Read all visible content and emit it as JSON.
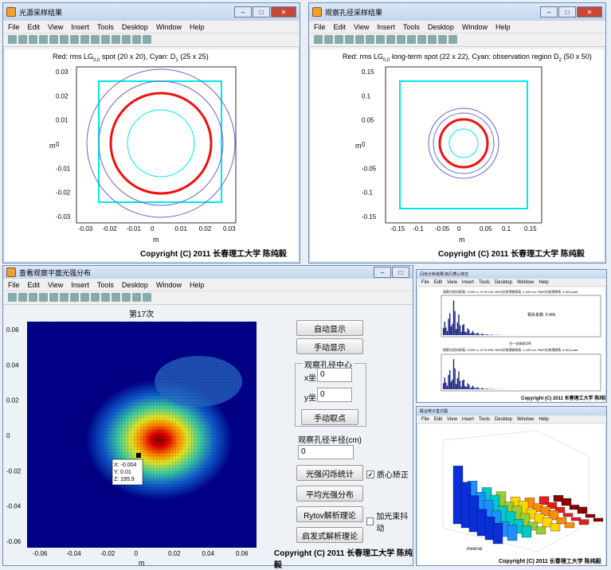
{
  "w1": {
    "title": "光源采样结果",
    "menu": [
      "File",
      "Edit",
      "View",
      "Insert",
      "Tools",
      "Desktop",
      "Window",
      "Help"
    ],
    "plot_title": "Red: rms LG",
    "plot_title_sub": "0,0",
    "plot_title_rest": " spot (20 x 20), Cyan: D",
    "plot_title_sub2": "1",
    "plot_title_end": " (25 x 25)",
    "ylabel": "m",
    "xlabel": "m",
    "xticks": [
      "-0.03",
      "-0.02",
      "-0.01",
      "0",
      "0.01",
      "0.02",
      "0.03"
    ],
    "yticks": [
      "0.03",
      "0.02",
      "0.01",
      "0",
      "-0.01",
      "-0.02",
      "-0.03"
    ],
    "copyright": "Copyright (C) 2011 长春理工大学 陈纯毅"
  },
  "w2": {
    "title": "观察孔径采样结果",
    "menu": [
      "File",
      "Edit",
      "View",
      "Insert",
      "Tools",
      "Desktop",
      "Window",
      "Help"
    ],
    "plot_title": "Red: rms LG",
    "plot_title_sub": "0,0",
    "plot_title_rest": " long-term  spot (22 x 22), Cyan: observation region D",
    "plot_title_sub2": "2",
    "plot_title_end": " (50 x 50)",
    "ylabel": "m",
    "xlabel": "m",
    "xticks": [
      "-0.15",
      "-0.1",
      "-0.05",
      "0",
      "0.05",
      "0.1",
      "0.15"
    ],
    "yticks": [
      "0.15",
      "0.1",
      "0.05",
      "0",
      "-0.05",
      "-0.1",
      "-0.15"
    ],
    "copyright": "Copyright (C) 2011 长春理工大学 陈纯毅"
  },
  "w3": {
    "title": "查看观察平面光强分布",
    "menu": [
      "File",
      "Edit",
      "View",
      "Insert",
      "Tools",
      "Desktop",
      "Window",
      "Help"
    ],
    "plot_title": "第17次",
    "xticks": [
      "-0.06",
      "-0.04",
      "-0.02",
      "0",
      "0.02",
      "0.04",
      "0.06"
    ],
    "yticks": [
      "0.06",
      "0.04",
      "0.02",
      "0",
      "-0.02",
      "-0.04",
      "-0.06"
    ],
    "xlabel": "m",
    "tooltip": [
      "X: -0.004",
      "Y: 0.01",
      "Z: 195.9"
    ],
    "auto_btn": "自动显示",
    "manual_btn": "手动显示",
    "group_label": "观察孔径中心",
    "x_label": "x坐",
    "x_value": "0",
    "y_label": "y坐",
    "y_value": "0",
    "pick_btn": "手动取点",
    "radius_label": "观察孔径半径(cm)",
    "radius_value": "0",
    "stat_btn": "光强闪烁统计",
    "centroid_label": "质心矫正",
    "avg_btn": "平均光强分布",
    "rytov_btn": "Rytov解析理论",
    "wander_label": "加光束抖动",
    "heur_btn": "启发式解析理论",
    "copyright": "Copyright (C) 2011 长春理工大学 陈纯毅"
  },
  "w4": {
    "title": "闪烁分析结果:执行质心校正",
    "menu": [
      "File",
      "Edit",
      "View",
      "Insert",
      "Tools",
      "Desktop",
      "Window",
      "Help"
    ],
    "top_caption": "观察点径向距离: 0.000 m, σ²=0.034, RMS光束漂移距离: 1.443 cm, RMS光束漂移角: 4.810 μrad",
    "corr_label": "相关系数: 0.406",
    "mid_label": "归一化接收功率",
    "bottom_caption": "观察点径向距离: 0.000 m, σ²=0.805, RMS光束漂移距离: 1.443 cm, RMS光束漂移角: 4.810 μrad",
    "ylabel": "直方图计数",
    "xticks_top": [
      "0",
      "1",
      "2",
      "3",
      "4",
      "5",
      "6"
    ],
    "copyright": "Copyright (C) 2011 长春理工大学 陈纯毅"
  },
  "w5": {
    "title": "联合统计直方图",
    "menu": [
      "File",
      "Edit",
      "View",
      "Insert",
      "Tools",
      "Desktop",
      "Window",
      "Help"
    ],
    "xlabel": "inverse",
    "copyright": "Copyright (C) 2011 长春理工大学 陈纯毅"
  }
}
